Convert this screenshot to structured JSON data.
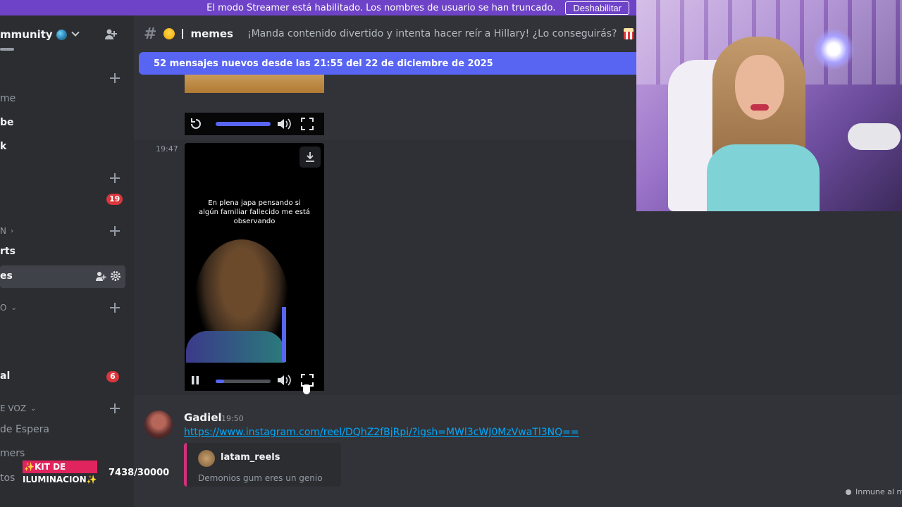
{
  "banner": {
    "text": "El modo Streamer está habilitado. Los nombres de usuario se han truncado.",
    "button": "Deshabilitar"
  },
  "server": {
    "name": "mmunity"
  },
  "sidebar": {
    "items": [
      {
        "label": "me"
      },
      {
        "label": "be"
      },
      {
        "label": "k"
      },
      {
        "label": "rts"
      },
      {
        "label": "es"
      },
      {
        "label": "al"
      },
      {
        "label": "de Espera"
      },
      {
        "label": "mers"
      },
      {
        "label": "tos"
      }
    ],
    "categories": [
      {
        "label": "N"
      },
      {
        "label": "O"
      },
      {
        "label": "E VOZ"
      }
    ],
    "badges": [
      "19",
      "6"
    ]
  },
  "channel": {
    "name": "memes",
    "topic": "¡Manda contenido divertido y intenta hacer reír a Hillary! ¿Lo conseguirás?"
  },
  "new_messages": "52 mensajes nuevos desde las 21:55 del 22 de diciembre de 2025",
  "video": {
    "timestamp": "19:47",
    "caption": "En plena japa pensando si algún familiar fallecido me está observando"
  },
  "message": {
    "author": "Gadiel",
    "time": "19:50",
    "link": "https://www.instagram.com/reel/DQhZ2fBjRpi/?igsh=MWl3cWJ0MzVwaTl3NQ==",
    "embed": {
      "author": "latam_reels",
      "description": "Demonios gum eres un genio"
    }
  },
  "overlay": {
    "kit_line1": "✨KIT DE",
    "kit_line2": "ILUMINACION✨",
    "kit_count": "7438/30000",
    "inmune": "Inmune al me"
  },
  "colors": {
    "accent": "#5865f2",
    "banner": "#6e43c7",
    "badge": "#da373c",
    "link": "#00a8fc"
  }
}
